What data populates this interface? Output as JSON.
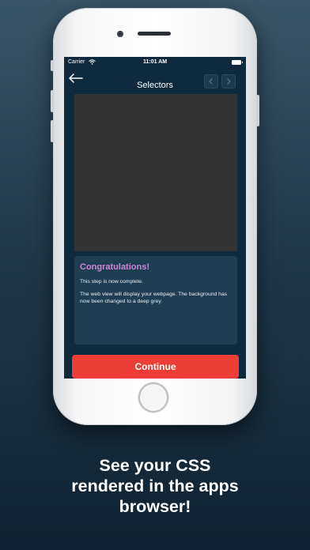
{
  "statusbar": {
    "carrier": "Carrier",
    "time": "11:01 AM"
  },
  "nav": {
    "title": "Selectors"
  },
  "message": {
    "title": "Congratulations!",
    "paragraphs": [
      "This step is now complete.",
      "The web view will display your webpage. The background has now been changed to a deep grey."
    ]
  },
  "continue_label": "Continue",
  "caption": {
    "lines": [
      "See your CSS",
      "rendered in the apps",
      "browser!"
    ]
  },
  "colors": {
    "screen_bg": "#0f2a3c",
    "webview_bg": "#333333",
    "card_bg": "#1f3e51",
    "accent_title": "#cc85d8",
    "button": "#ec3e36"
  },
  "icons": [
    "wifi-icon",
    "battery-icon",
    "back-arrow-icon",
    "chevron-left-icon",
    "chevron-right-icon"
  ]
}
